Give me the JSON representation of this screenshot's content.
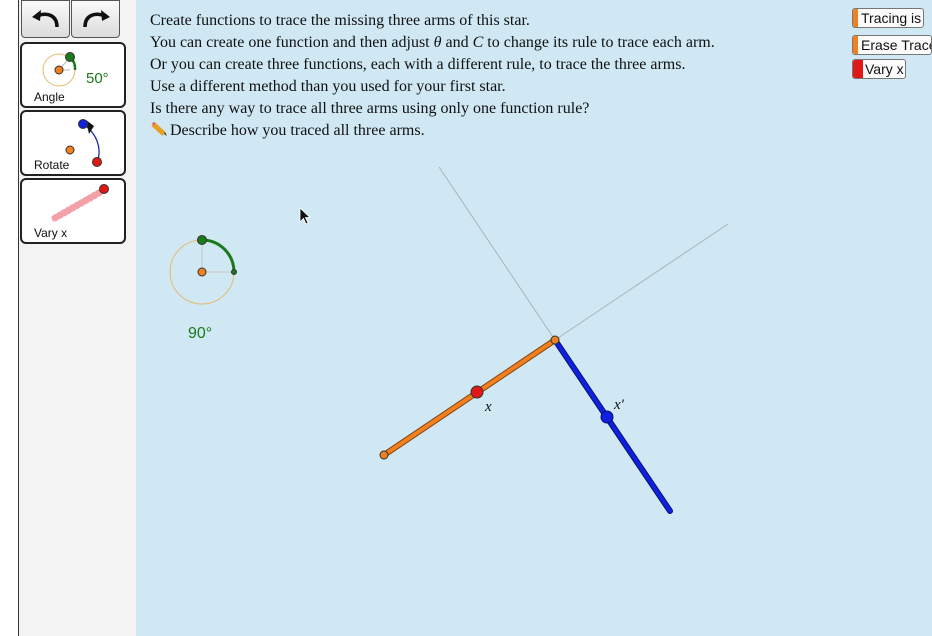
{
  "toolbar": {
    "undo_icon": "undo-arrow-icon",
    "redo_icon": "redo-arrow-icon"
  },
  "tools": [
    {
      "label": "Angle",
      "value": "50°"
    },
    {
      "label": "Rotate"
    },
    {
      "label": "Vary x"
    }
  ],
  "instructions": {
    "line1": "Create functions to trace the missing three arms of this star.",
    "line2_a": "You can create one function and then adjust ",
    "line2_theta": "θ",
    "line2_b": " and ",
    "line2_c": "C",
    "line2_d": " to change its rule to trace each arm.",
    "line3": "Or you can create three functions, each with a different rule, to trace the three arms.",
    "line4": "Use a different method than you used for your first star.",
    "line5": "Is there any way to trace all three arms using only one function rule?",
    "line6": "Describe how you traced all three arms."
  },
  "buttons": {
    "tracing": "Tracing is",
    "erase": "Erase Traces",
    "vary": "Vary x"
  },
  "canvas": {
    "angle_label": "90°",
    "point_x_label": "x",
    "point_xprime_label": "x′"
  },
  "colors": {
    "canvas_bg": "#cfe8f3",
    "orange": "#f08020",
    "blue": "#1020e0",
    "red": "#e01818",
    "green": "#1a7a1a"
  }
}
